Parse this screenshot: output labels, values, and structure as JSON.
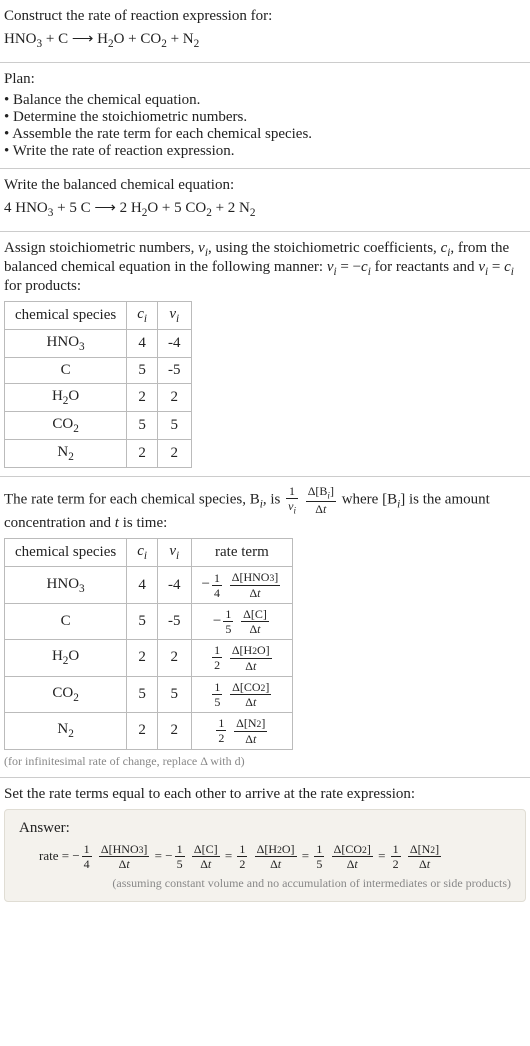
{
  "prompt": {
    "title": "Construct the rate of reaction expression for:",
    "equation_plain": "HNO3 + C ⟶ H2O + CO2 + N2"
  },
  "plan": {
    "heading": "Plan:",
    "items": [
      "Balance the chemical equation.",
      "Determine the stoichiometric numbers.",
      "Assemble the rate term for each chemical species.",
      "Write the rate of reaction expression."
    ]
  },
  "balanced": {
    "heading": "Write the balanced chemical equation:",
    "equation_plain": "4 HNO3 + 5 C ⟶ 2 H2O + 5 CO2 + 2 N2"
  },
  "stoich": {
    "intro_a": "Assign stoichiometric numbers, ",
    "intro_b": ", using the stoichiometric coefficients, ",
    "intro_c": ", from the balanced chemical equation in the following manner: ",
    "intro_d": " for reactants and ",
    "intro_e": " for products:",
    "nu_eq_neg_c": "ν_i = −c_i",
    "nu_eq_c": "ν_i = c_i",
    "headers": {
      "species": "chemical species",
      "c": "c_i",
      "nu": "ν_i"
    },
    "rows": [
      {
        "species": "HNO3",
        "c": "4",
        "nu": "-4"
      },
      {
        "species": "C",
        "c": "5",
        "nu": "-5"
      },
      {
        "species": "H2O",
        "c": "2",
        "nu": "2"
      },
      {
        "species": "CO2",
        "c": "5",
        "nu": "5"
      },
      {
        "species": "N2",
        "c": "2",
        "nu": "2"
      }
    ]
  },
  "rateterm": {
    "intro_a": "The rate term for each chemical species, B",
    "intro_b": ", is ",
    "intro_c": " where [B",
    "intro_d": "] is the amount concentration and ",
    "intro_e": " is time:",
    "headers": {
      "species": "chemical species",
      "c": "c_i",
      "nu": "ν_i",
      "term": "rate term"
    },
    "rows": [
      {
        "species": "HNO3",
        "c": "4",
        "nu": "-4",
        "coef_num": "1",
        "coef_den": "4",
        "sign": "−",
        "dnum": "Δ[HNO3]",
        "dden": "Δt"
      },
      {
        "species": "C",
        "c": "5",
        "nu": "-5",
        "coef_num": "1",
        "coef_den": "5",
        "sign": "−",
        "dnum": "Δ[C]",
        "dden": "Δt"
      },
      {
        "species": "H2O",
        "c": "2",
        "nu": "2",
        "coef_num": "1",
        "coef_den": "2",
        "sign": "",
        "dnum": "Δ[H2O]",
        "dden": "Δt"
      },
      {
        "species": "CO2",
        "c": "5",
        "nu": "5",
        "coef_num": "1",
        "coef_den": "5",
        "sign": "",
        "dnum": "Δ[CO2]",
        "dden": "Δt"
      },
      {
        "species": "N2",
        "c": "2",
        "nu": "2",
        "coef_num": "1",
        "coef_den": "2",
        "sign": "",
        "dnum": "Δ[N2]",
        "dden": "Δt"
      }
    ],
    "note": "(for infinitesimal rate of change, replace Δ with d)"
  },
  "final": {
    "heading": "Set the rate terms equal to each other to arrive at the rate expression:",
    "answer_label": "Answer:",
    "rate_prefix": "rate = ",
    "terms": [
      {
        "sign": "−",
        "cnum": "1",
        "cden": "4",
        "dnum": "Δ[HNO3]",
        "dden": "Δt"
      },
      {
        "sign": "−",
        "cnum": "1",
        "cden": "5",
        "dnum": "Δ[C]",
        "dden": "Δt"
      },
      {
        "sign": "",
        "cnum": "1",
        "cden": "2",
        "dnum": "Δ[H2O]",
        "dden": "Δt"
      },
      {
        "sign": "",
        "cnum": "1",
        "cden": "5",
        "dnum": "Δ[CO2]",
        "dden": "Δt"
      },
      {
        "sign": "",
        "cnum": "1",
        "cden": "2",
        "dnum": "Δ[N2]",
        "dden": "Δt"
      }
    ],
    "note": "(assuming constant volume and no accumulation of intermediates or side products)"
  },
  "chart_data": {
    "type": "table",
    "title": "Stoichiometric numbers and rate terms for HNO3 + C → H2O + CO2 + N2",
    "balanced_equation": "4 HNO3 + 5 C → 2 H2O + 5 CO2 + 2 N2",
    "species": [
      "HNO3",
      "C",
      "H2O",
      "CO2",
      "N2"
    ],
    "stoichiometric_coefficients_c": [
      4,
      5,
      2,
      5,
      2
    ],
    "stoichiometric_numbers_nu": [
      -4,
      -5,
      2,
      5,
      2
    ],
    "rate_expression": "rate = -(1/4) d[HNO3]/dt = -(1/5) d[C]/dt = (1/2) d[H2O]/dt = (1/5) d[CO2]/dt = (1/2) d[N2]/dt"
  }
}
